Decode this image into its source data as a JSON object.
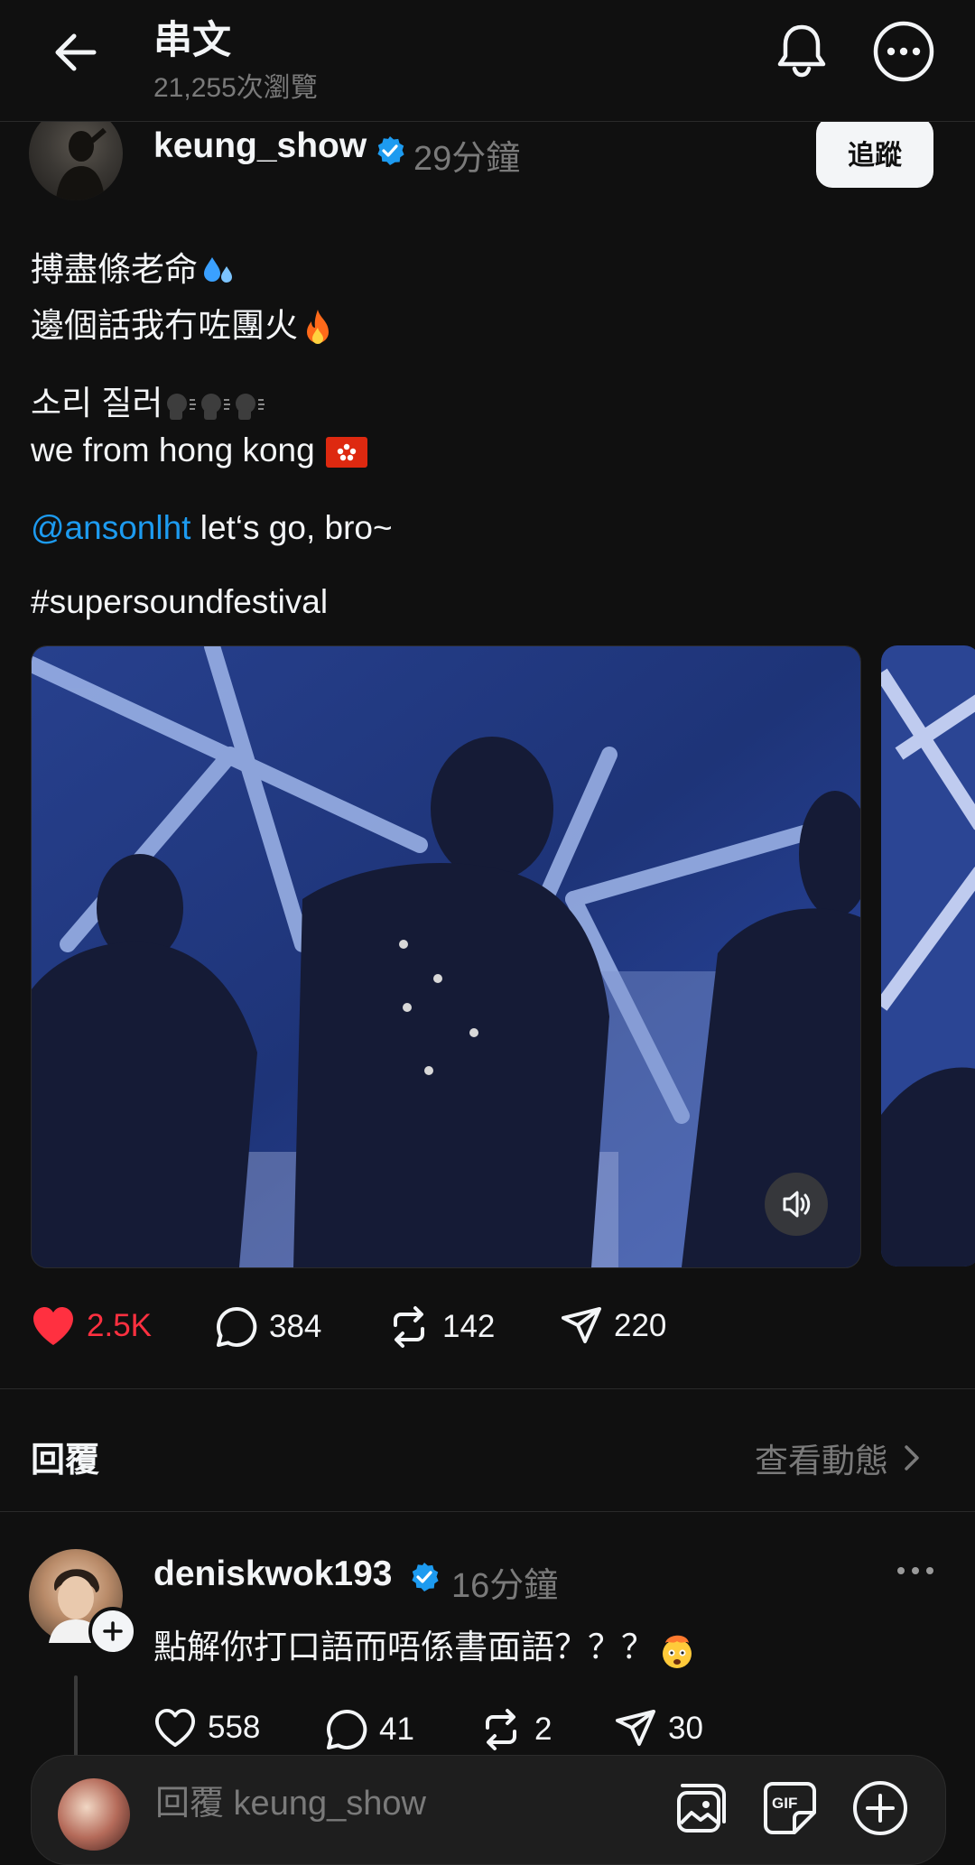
{
  "header": {
    "title": "串文",
    "views": "21,255次瀏覽"
  },
  "post": {
    "author": "keung_show",
    "time": "29分鐘",
    "follow_label": "追蹤",
    "line1": "搏盡條老命",
    "line2": "邊個話我冇咗團火",
    "line3": "소리 질러",
    "line4": "we from hong kong",
    "mention": "@ansonlht",
    "mention_rest": "let‘s go, bro~",
    "hashtag": "#supersoundfestival",
    "likes": "2.5K",
    "comments": "384",
    "reposts": "142",
    "shares": "220"
  },
  "replies_section": {
    "heading": "回覆",
    "activity_link": "查看動態"
  },
  "reply": {
    "author": "deniskwok193",
    "time": "16分鐘",
    "text": "點解你打口語而唔係書面語？？？",
    "likes": "558",
    "comments": "41",
    "reposts": "2",
    "shares": "30"
  },
  "composer": {
    "placeholder": "回覆 keung_show"
  },
  "colors": {
    "background": "#101010",
    "text": "#f3f5f7",
    "muted": "#7a7a7a",
    "like_active": "#ff3040",
    "mention": "#1d9bf0",
    "verified": "#1d9bf0"
  }
}
